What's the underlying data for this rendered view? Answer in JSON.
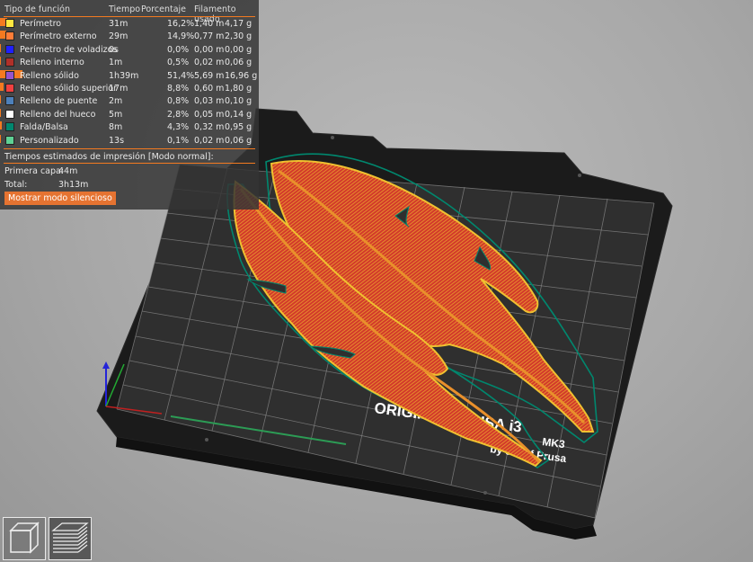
{
  "legend": {
    "headers": {
      "feature": "Tipo de función",
      "time": "Tiempo",
      "percent": "Porcentaje",
      "filament": "Filamento usado"
    },
    "rows": [
      {
        "name": "Perímetro",
        "time": "31m",
        "percent": "16,2%",
        "length": "1,40 m",
        "weight": "4,17 g",
        "color": "#ffe640",
        "fraction": 0.162
      },
      {
        "name": "Perímetro externo",
        "time": "29m",
        "percent": "14,9%",
        "length": "0,77 m",
        "weight": "2,30 g",
        "color": "#ff7d38",
        "fraction": 0.149
      },
      {
        "name": "Perímetro de voladizos",
        "time": "0s",
        "percent": "0,0%",
        "length": "0,00 m",
        "weight": "0,00 g",
        "color": "#1f1fff",
        "fraction": 0.0
      },
      {
        "name": "Relleno interno",
        "time": "1m",
        "percent": "0,5%",
        "length": "0,02 m",
        "weight": "0,06 g",
        "color": "#b03029",
        "fraction": 0.005
      },
      {
        "name": "Relleno sólido",
        "time": "1h39m",
        "percent": "51,4%",
        "length": "5,69 m",
        "weight": "16,96 g",
        "color": "#9654cc",
        "fraction": 0.514
      },
      {
        "name": "Relleno sólido superior",
        "time": "17m",
        "percent": "8,8%",
        "length": "0,60 m",
        "weight": "1,80 g",
        "color": "#f04040",
        "fraction": 0.088
      },
      {
        "name": "Relleno de puente",
        "time": "2m",
        "percent": "0,8%",
        "length": "0,03 m",
        "weight": "0,10 g",
        "color": "#4d80ba",
        "fraction": 0.008
      },
      {
        "name": "Relleno del hueco",
        "time": "5m",
        "percent": "2,8%",
        "length": "0,05 m",
        "weight": "0,14 g",
        "color": "#ffffff",
        "fraction": 0.028
      },
      {
        "name": "Falda/Balsa",
        "time": "8m",
        "percent": "4,3%",
        "length": "0,32 m",
        "weight": "0,95 g",
        "color": "#00876e",
        "fraction": 0.043
      },
      {
        "name": "Personalizado",
        "time": "13s",
        "percent": "0,1%",
        "length": "0,02 m",
        "weight": "0,06 g",
        "color": "#5ed194",
        "fraction": 0.001
      }
    ]
  },
  "estimates": {
    "title": "Tiempos estimados de impresión [Modo normal]:",
    "first_layer_label": "Primera capa:",
    "first_layer_value": "44m",
    "total_label": "Total:",
    "total_value": "3h13m",
    "silent_button": "Mostrar modo silencioso"
  },
  "bed": {
    "brand_line1": "ORIGINAL PRUSA i3",
    "brand_model": "MK3",
    "brand_line2": "by Josef Prusa"
  },
  "view_buttons": {
    "left_icon": "cube-3d-view-icon",
    "right_icon": "layers-preview-icon"
  }
}
